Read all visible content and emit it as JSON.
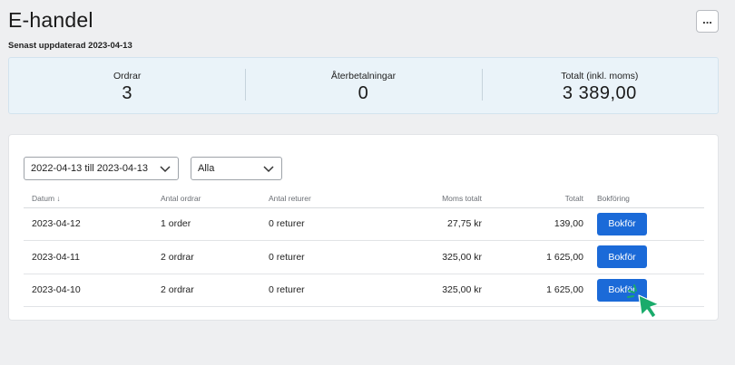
{
  "header": {
    "title": "E-handel",
    "more_label": "...",
    "updated": "Senast uppdaterad 2023-04-13"
  },
  "stats": [
    {
      "label": "Ordrar",
      "value": "3"
    },
    {
      "label": "Återbetalningar",
      "value": "0"
    },
    {
      "label": "Totalt (inkl. moms)",
      "value": "3 389,00"
    }
  ],
  "filters": {
    "date_range": "2022-04-13 till 2023-04-13",
    "status": "Alla"
  },
  "table": {
    "columns": [
      "Datum ↓",
      "Antal ordrar",
      "Antal returer",
      "Moms totalt",
      "Totalt",
      "Bokföring"
    ],
    "rows": [
      {
        "date": "2023-04-12",
        "orders": "1 order",
        "returns": "0 returer",
        "vat": "27,75 kr",
        "total": "139,00",
        "action": "Bokför"
      },
      {
        "date": "2023-04-11",
        "orders": "2 ordrar",
        "returns": "0 returer",
        "vat": "325,00 kr",
        "total": "1 625,00",
        "action": "Bokför"
      },
      {
        "date": "2023-04-10",
        "orders": "2 ordrar",
        "returns": "0 returer",
        "vat": "325,00 kr",
        "total": "1 625,00",
        "action": "Bokför"
      }
    ]
  },
  "colors": {
    "accent": "#1b6ad8",
    "stats_bg": "#eaf3f9",
    "cursor": "#1aab6b"
  }
}
